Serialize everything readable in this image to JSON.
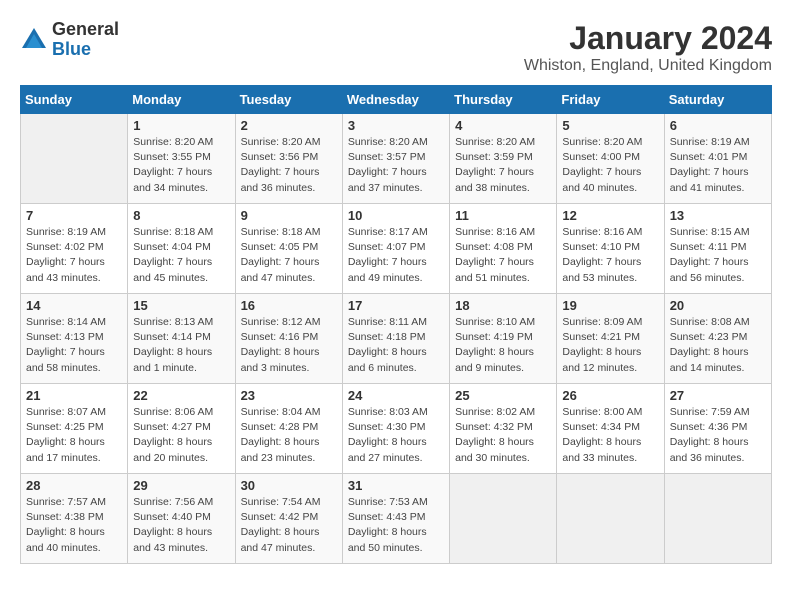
{
  "logo": {
    "general": "General",
    "blue": "Blue"
  },
  "title": "January 2024",
  "location": "Whiston, England, United Kingdom",
  "days_header": [
    "Sunday",
    "Monday",
    "Tuesday",
    "Wednesday",
    "Thursday",
    "Friday",
    "Saturday"
  ],
  "weeks": [
    [
      {
        "num": "",
        "empty": true
      },
      {
        "num": "1",
        "sunrise": "Sunrise: 8:20 AM",
        "sunset": "Sunset: 3:55 PM",
        "daylight": "Daylight: 7 hours and 34 minutes."
      },
      {
        "num": "2",
        "sunrise": "Sunrise: 8:20 AM",
        "sunset": "Sunset: 3:56 PM",
        "daylight": "Daylight: 7 hours and 36 minutes."
      },
      {
        "num": "3",
        "sunrise": "Sunrise: 8:20 AM",
        "sunset": "Sunset: 3:57 PM",
        "daylight": "Daylight: 7 hours and 37 minutes."
      },
      {
        "num": "4",
        "sunrise": "Sunrise: 8:20 AM",
        "sunset": "Sunset: 3:59 PM",
        "daylight": "Daylight: 7 hours and 38 minutes."
      },
      {
        "num": "5",
        "sunrise": "Sunrise: 8:20 AM",
        "sunset": "Sunset: 4:00 PM",
        "daylight": "Daylight: 7 hours and 40 minutes."
      },
      {
        "num": "6",
        "sunrise": "Sunrise: 8:19 AM",
        "sunset": "Sunset: 4:01 PM",
        "daylight": "Daylight: 7 hours and 41 minutes."
      }
    ],
    [
      {
        "num": "7",
        "sunrise": "Sunrise: 8:19 AM",
        "sunset": "Sunset: 4:02 PM",
        "daylight": "Daylight: 7 hours and 43 minutes."
      },
      {
        "num": "8",
        "sunrise": "Sunrise: 8:18 AM",
        "sunset": "Sunset: 4:04 PM",
        "daylight": "Daylight: 7 hours and 45 minutes."
      },
      {
        "num": "9",
        "sunrise": "Sunrise: 8:18 AM",
        "sunset": "Sunset: 4:05 PM",
        "daylight": "Daylight: 7 hours and 47 minutes."
      },
      {
        "num": "10",
        "sunrise": "Sunrise: 8:17 AM",
        "sunset": "Sunset: 4:07 PM",
        "daylight": "Daylight: 7 hours and 49 minutes."
      },
      {
        "num": "11",
        "sunrise": "Sunrise: 8:16 AM",
        "sunset": "Sunset: 4:08 PM",
        "daylight": "Daylight: 7 hours and 51 minutes."
      },
      {
        "num": "12",
        "sunrise": "Sunrise: 8:16 AM",
        "sunset": "Sunset: 4:10 PM",
        "daylight": "Daylight: 7 hours and 53 minutes."
      },
      {
        "num": "13",
        "sunrise": "Sunrise: 8:15 AM",
        "sunset": "Sunset: 4:11 PM",
        "daylight": "Daylight: 7 hours and 56 minutes."
      }
    ],
    [
      {
        "num": "14",
        "sunrise": "Sunrise: 8:14 AM",
        "sunset": "Sunset: 4:13 PM",
        "daylight": "Daylight: 7 hours and 58 minutes."
      },
      {
        "num": "15",
        "sunrise": "Sunrise: 8:13 AM",
        "sunset": "Sunset: 4:14 PM",
        "daylight": "Daylight: 8 hours and 1 minute."
      },
      {
        "num": "16",
        "sunrise": "Sunrise: 8:12 AM",
        "sunset": "Sunset: 4:16 PM",
        "daylight": "Daylight: 8 hours and 3 minutes."
      },
      {
        "num": "17",
        "sunrise": "Sunrise: 8:11 AM",
        "sunset": "Sunset: 4:18 PM",
        "daylight": "Daylight: 8 hours and 6 minutes."
      },
      {
        "num": "18",
        "sunrise": "Sunrise: 8:10 AM",
        "sunset": "Sunset: 4:19 PM",
        "daylight": "Daylight: 8 hours and 9 minutes."
      },
      {
        "num": "19",
        "sunrise": "Sunrise: 8:09 AM",
        "sunset": "Sunset: 4:21 PM",
        "daylight": "Daylight: 8 hours and 12 minutes."
      },
      {
        "num": "20",
        "sunrise": "Sunrise: 8:08 AM",
        "sunset": "Sunset: 4:23 PM",
        "daylight": "Daylight: 8 hours and 14 minutes."
      }
    ],
    [
      {
        "num": "21",
        "sunrise": "Sunrise: 8:07 AM",
        "sunset": "Sunset: 4:25 PM",
        "daylight": "Daylight: 8 hours and 17 minutes."
      },
      {
        "num": "22",
        "sunrise": "Sunrise: 8:06 AM",
        "sunset": "Sunset: 4:27 PM",
        "daylight": "Daylight: 8 hours and 20 minutes."
      },
      {
        "num": "23",
        "sunrise": "Sunrise: 8:04 AM",
        "sunset": "Sunset: 4:28 PM",
        "daylight": "Daylight: 8 hours and 23 minutes."
      },
      {
        "num": "24",
        "sunrise": "Sunrise: 8:03 AM",
        "sunset": "Sunset: 4:30 PM",
        "daylight": "Daylight: 8 hours and 27 minutes."
      },
      {
        "num": "25",
        "sunrise": "Sunrise: 8:02 AM",
        "sunset": "Sunset: 4:32 PM",
        "daylight": "Daylight: 8 hours and 30 minutes."
      },
      {
        "num": "26",
        "sunrise": "Sunrise: 8:00 AM",
        "sunset": "Sunset: 4:34 PM",
        "daylight": "Daylight: 8 hours and 33 minutes."
      },
      {
        "num": "27",
        "sunrise": "Sunrise: 7:59 AM",
        "sunset": "Sunset: 4:36 PM",
        "daylight": "Daylight: 8 hours and 36 minutes."
      }
    ],
    [
      {
        "num": "28",
        "sunrise": "Sunrise: 7:57 AM",
        "sunset": "Sunset: 4:38 PM",
        "daylight": "Daylight: 8 hours and 40 minutes."
      },
      {
        "num": "29",
        "sunrise": "Sunrise: 7:56 AM",
        "sunset": "Sunset: 4:40 PM",
        "daylight": "Daylight: 8 hours and 43 minutes."
      },
      {
        "num": "30",
        "sunrise": "Sunrise: 7:54 AM",
        "sunset": "Sunset: 4:42 PM",
        "daylight": "Daylight: 8 hours and 47 minutes."
      },
      {
        "num": "31",
        "sunrise": "Sunrise: 7:53 AM",
        "sunset": "Sunset: 4:43 PM",
        "daylight": "Daylight: 8 hours and 50 minutes."
      },
      {
        "num": "",
        "empty": true
      },
      {
        "num": "",
        "empty": true
      },
      {
        "num": "",
        "empty": true
      }
    ]
  ]
}
